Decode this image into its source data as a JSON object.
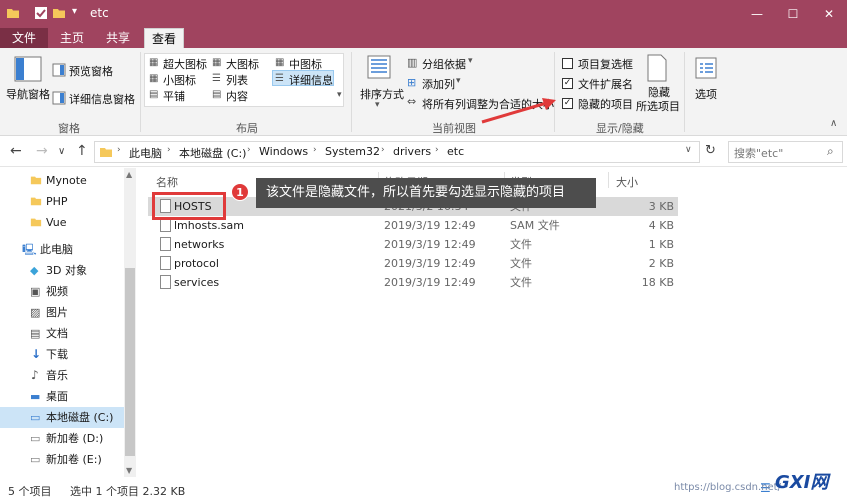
{
  "window": {
    "title": "etc",
    "controls": [
      "—",
      "☐",
      "✕"
    ]
  },
  "ribbon_tabs": [
    "文件",
    "主页",
    "共享",
    "查看"
  ],
  "ribbon": {
    "panes": {
      "nav_pane": "导航窗格",
      "preview_pane": "预览窗格",
      "details_pane": "详细信息窗格",
      "group_label": "窗格"
    },
    "layout": {
      "items": [
        "超大图标",
        "大图标",
        "中图标",
        "小图标",
        "列表",
        "详细信息",
        "平铺",
        "内容"
      ],
      "group_label": "布局"
    },
    "current_view": {
      "sort_by": "排序方式",
      "group_by": "分组依据",
      "add_column": "添加列",
      "fit_columns": "将所有列调整为合适的大小",
      "group_label": "当前视图"
    },
    "show_hide": {
      "item_checkboxes": "项目复选框",
      "file_extensions": "文件扩展名",
      "hidden_items": "隐藏的项目",
      "hide_selected_line1": "隐藏",
      "hide_selected_line2": "所选项目",
      "group_label": "显示/隐藏",
      "checked": {
        "item_checkboxes": false,
        "file_extensions": true,
        "hidden_items": true
      }
    },
    "options": "选项"
  },
  "address": {
    "path": [
      "此电脑",
      "本地磁盘 (C:)",
      "Windows",
      "System32",
      "drivers",
      "etc"
    ],
    "search_placeholder": "搜索\"etc\""
  },
  "nav_pane": {
    "items": [
      {
        "label": "Mynote",
        "icon": "folder-icon"
      },
      {
        "label": "PHP",
        "icon": "folder-icon"
      },
      {
        "label": "Vue",
        "icon": "folder-icon"
      },
      {
        "label": "此电脑",
        "icon": "computer-icon"
      },
      {
        "label": "3D 对象",
        "icon": "cube-icon"
      },
      {
        "label": "视频",
        "icon": "video-icon"
      },
      {
        "label": "图片",
        "icon": "image-icon"
      },
      {
        "label": "文档",
        "icon": "document-icon"
      },
      {
        "label": "下载",
        "icon": "download-icon"
      },
      {
        "label": "音乐",
        "icon": "music-icon"
      },
      {
        "label": "桌面",
        "icon": "desktop-icon"
      },
      {
        "label": "本地磁盘 (C:)",
        "icon": "drive-icon"
      },
      {
        "label": "新加卷 (D:)",
        "icon": "drive-icon"
      },
      {
        "label": "新加卷 (E:)",
        "icon": "drive-icon"
      }
    ]
  },
  "file_list": {
    "columns": [
      "名称",
      "修改日期",
      "类型",
      "大小"
    ],
    "rows": [
      {
        "name": "HOSTS",
        "date": "2021/3/2 16:34",
        "type": "文件",
        "size": "3 KB"
      },
      {
        "name": "lmhosts.sam",
        "date": "2019/3/19 12:49",
        "type": "SAM 文件",
        "size": "4 KB"
      },
      {
        "name": "networks",
        "date": "2019/3/19 12:49",
        "type": "文件",
        "size": "1 KB"
      },
      {
        "name": "protocol",
        "date": "2019/3/19 12:49",
        "type": "文件",
        "size": "2 KB"
      },
      {
        "name": "services",
        "date": "2019/3/19 12:49",
        "type": "文件",
        "size": "18 KB"
      }
    ]
  },
  "status_bar": {
    "count": "5 个项目",
    "selection": "选中 1 个项目  2.32 KB"
  },
  "annotation": {
    "badge": "1",
    "text": "该文件是隐藏文件，所以首先要勾选显示隐藏的项目"
  },
  "watermark": "https://blog.csdn.net/",
  "logo": "GXI网"
}
